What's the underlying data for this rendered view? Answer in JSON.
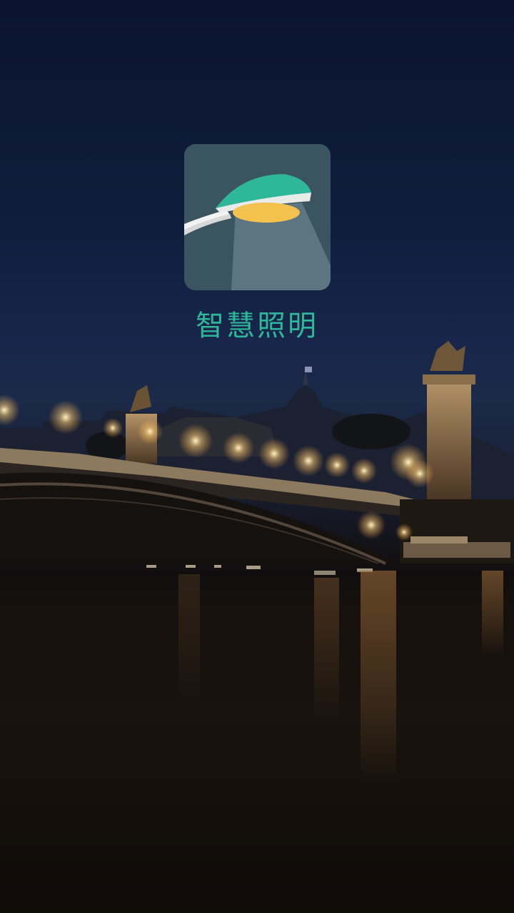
{
  "splash": {
    "app_name": "智慧照明",
    "icon": "street-lamp-icon",
    "background": "night-bridge-river-photo"
  },
  "colors": {
    "title": "#2fb79a",
    "icon_bg": "#3a5560",
    "lamp_shade": "#2fb79a",
    "lamp_light": "#f2c14e",
    "sky_top": "#0a1430"
  }
}
